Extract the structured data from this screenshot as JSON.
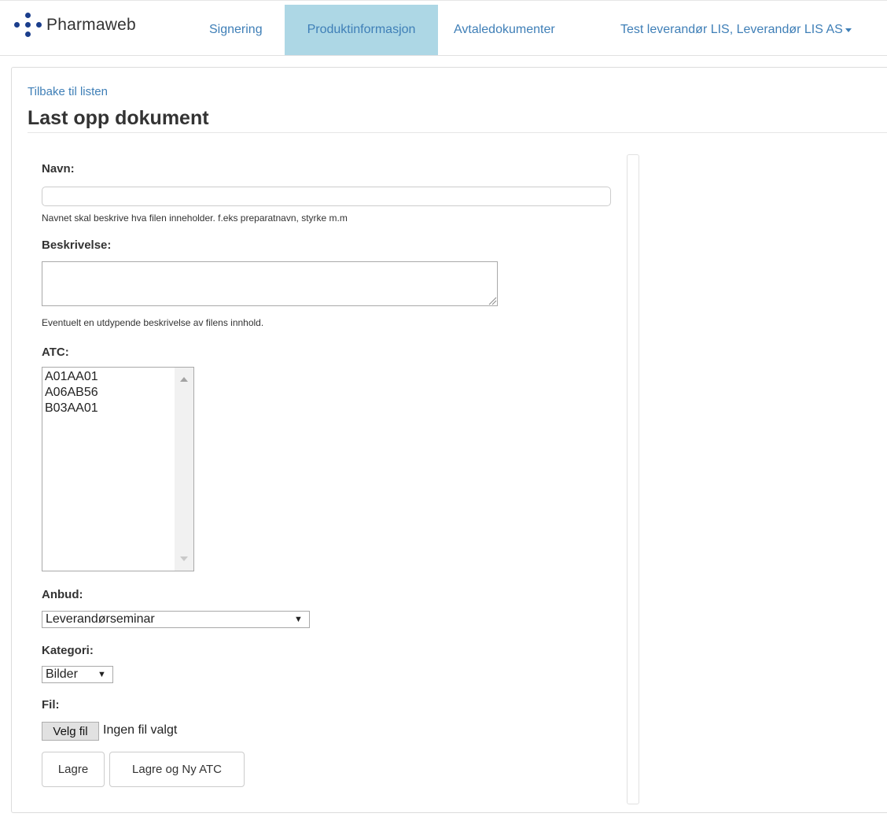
{
  "brand": {
    "name": "Pharmaweb"
  },
  "nav": {
    "items": [
      {
        "label": "Signering"
      },
      {
        "label": "Produktinformasjon",
        "active": true
      },
      {
        "label": "Avtaledokumenter"
      }
    ],
    "user_menu": "Test leverandør LIS, Leverandør LIS AS"
  },
  "page": {
    "back_link": "Tilbake til listen",
    "title": "Last opp dokument"
  },
  "form": {
    "name": {
      "label": "Navn:",
      "value": "",
      "help": "Navnet skal beskrive hva filen inneholder. f.eks preparatnavn, styrke m.m"
    },
    "description": {
      "label": "Beskrivelse:",
      "value": "",
      "help": "Eventuelt en utdypende beskrivelse av filens innhold."
    },
    "atc": {
      "label": "ATC:",
      "options": [
        "A01AA01",
        "A06AB56",
        "B03AA01"
      ]
    },
    "tender": {
      "label": "Anbud:",
      "selected": "Leverandørseminar"
    },
    "category": {
      "label": "Kategori:",
      "selected": "Bilder"
    },
    "file": {
      "label": "Fil:",
      "button": "Velg fil",
      "status": "Ingen fil valgt"
    },
    "actions": {
      "save": "Lagre",
      "save_new_atc": "Lagre og Ny ATC"
    }
  },
  "colors": {
    "link": "#3f7fb7",
    "nav_active_bg": "#add7e5",
    "logo": "#1b3e8c"
  }
}
